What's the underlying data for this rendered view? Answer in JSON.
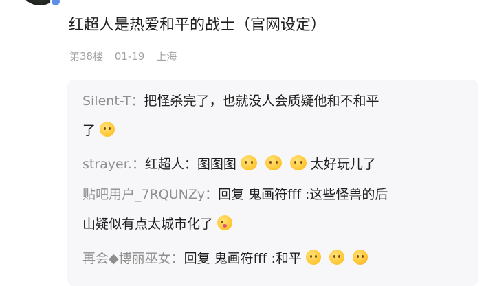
{
  "post": {
    "title": "红超人是热爱和平的战士（官网设定）",
    "floor": "第38楼",
    "date": "01-19",
    "location": "上海"
  },
  "replies": [
    {
      "user": "Silent-T：",
      "text_line1": "把怪杀完了，也就没人会质疑他和不和平",
      "text_line2": "了",
      "emojis": [
        "smile-emoji"
      ]
    },
    {
      "user": "strayer.：",
      "text": "红超人：图图图",
      "text_after": "太好玩儿了",
      "emojis": [
        "hands-cover-emoji",
        "hands-cover-emoji",
        "hands-cover-emoji"
      ]
    },
    {
      "user": "贴吧用户_7RQUNZy：",
      "text_line1": "回复 鬼画符fff :这些怪兽的后",
      "text_line2": "山疑似有点太城市化了",
      "emojis": [
        "tongue-emoji"
      ]
    },
    {
      "user": "再会◆博丽巫女：",
      "text": "回复 鬼画符fff :和平",
      "emojis": [
        "worried-emoji",
        "smile-emoji",
        "blush-emoji"
      ]
    }
  ]
}
